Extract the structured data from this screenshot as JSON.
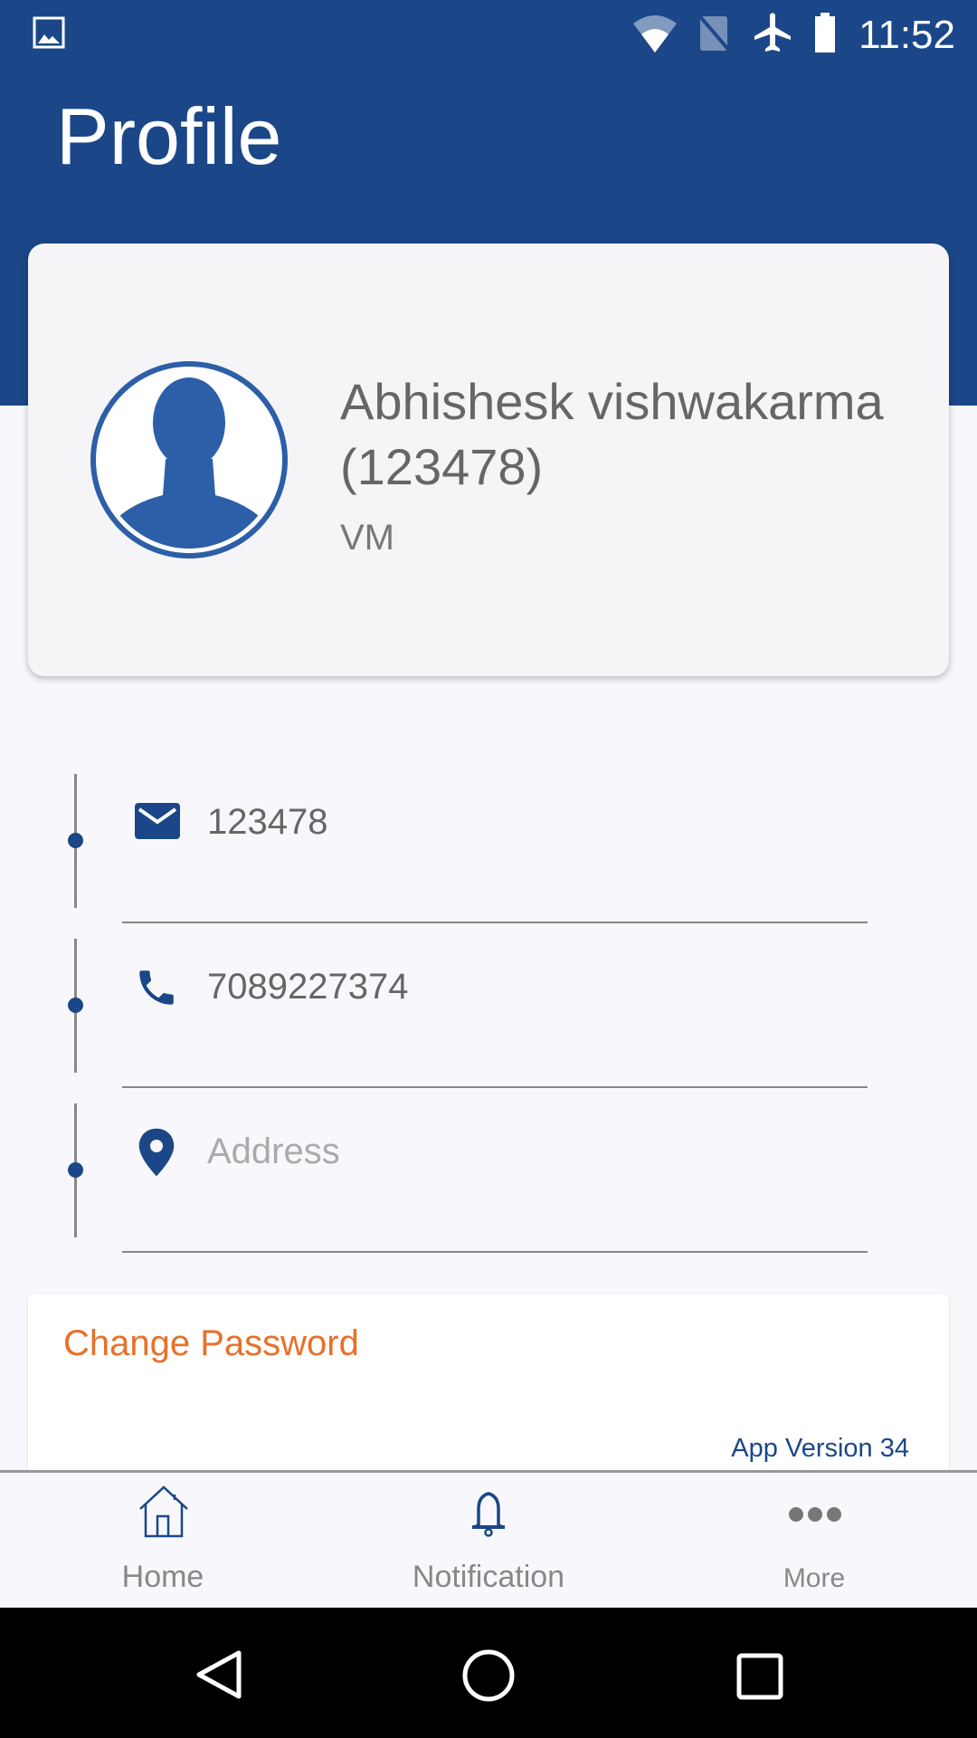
{
  "status_bar": {
    "time": "11:52",
    "icons": [
      "image-icon",
      "wifi-icon",
      "no-sim-icon",
      "airplane-icon",
      "battery-icon"
    ]
  },
  "header": {
    "title": "Profile"
  },
  "profile": {
    "name": "Abhishesk vishwakarma",
    "id": "(123478)",
    "role": "VM"
  },
  "details": [
    {
      "icon": "mail-icon",
      "value": "123478",
      "placeholder": false
    },
    {
      "icon": "phone-icon",
      "value": "7089227374",
      "placeholder": false
    },
    {
      "icon": "location-pin-icon",
      "value": "Address",
      "placeholder": true
    }
  ],
  "actions": {
    "change_password": "Change Password",
    "app_version": "App Version 34"
  },
  "bottom_nav": [
    {
      "label": "Home",
      "icon": "home-icon"
    },
    {
      "label": "Notification",
      "icon": "bell-icon"
    },
    {
      "label": "More",
      "icon": "more-dots-icon"
    }
  ],
  "colors": {
    "primary": "#1b4788",
    "accent": "#e8702a"
  }
}
